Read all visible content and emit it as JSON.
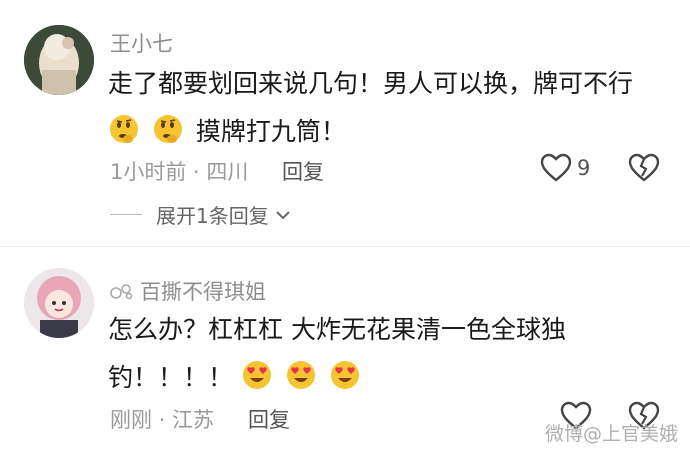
{
  "comments": [
    {
      "username": "王小七",
      "text_line1": "走了都要划回来说几句！男人可以换，牌可不行",
      "text_line2": "摸牌打九筒！",
      "meta": "1小时前 · 四川",
      "reply_label": "回复",
      "like_count": "9",
      "expand_label": "展开1条回复",
      "emoji_line2": [
        "thinking-face-emoji",
        "thinking-face-emoji"
      ]
    },
    {
      "username": "百撕不得琪姐",
      "text_line1": "怎么办？杠杠杠  大炸无花果清一色全球独",
      "text_line2": "钓！！！！",
      "meta": "刚刚 · 江苏",
      "reply_label": "回复",
      "emoji_line2": [
        "heart-eyes-emoji",
        "heart-eyes-emoji",
        "heart-eyes-emoji"
      ]
    }
  ],
  "watermark": "微博@上官美娥",
  "colors": {
    "emoji_yellow": "#f5c431",
    "heart_red": "#e8344a"
  }
}
